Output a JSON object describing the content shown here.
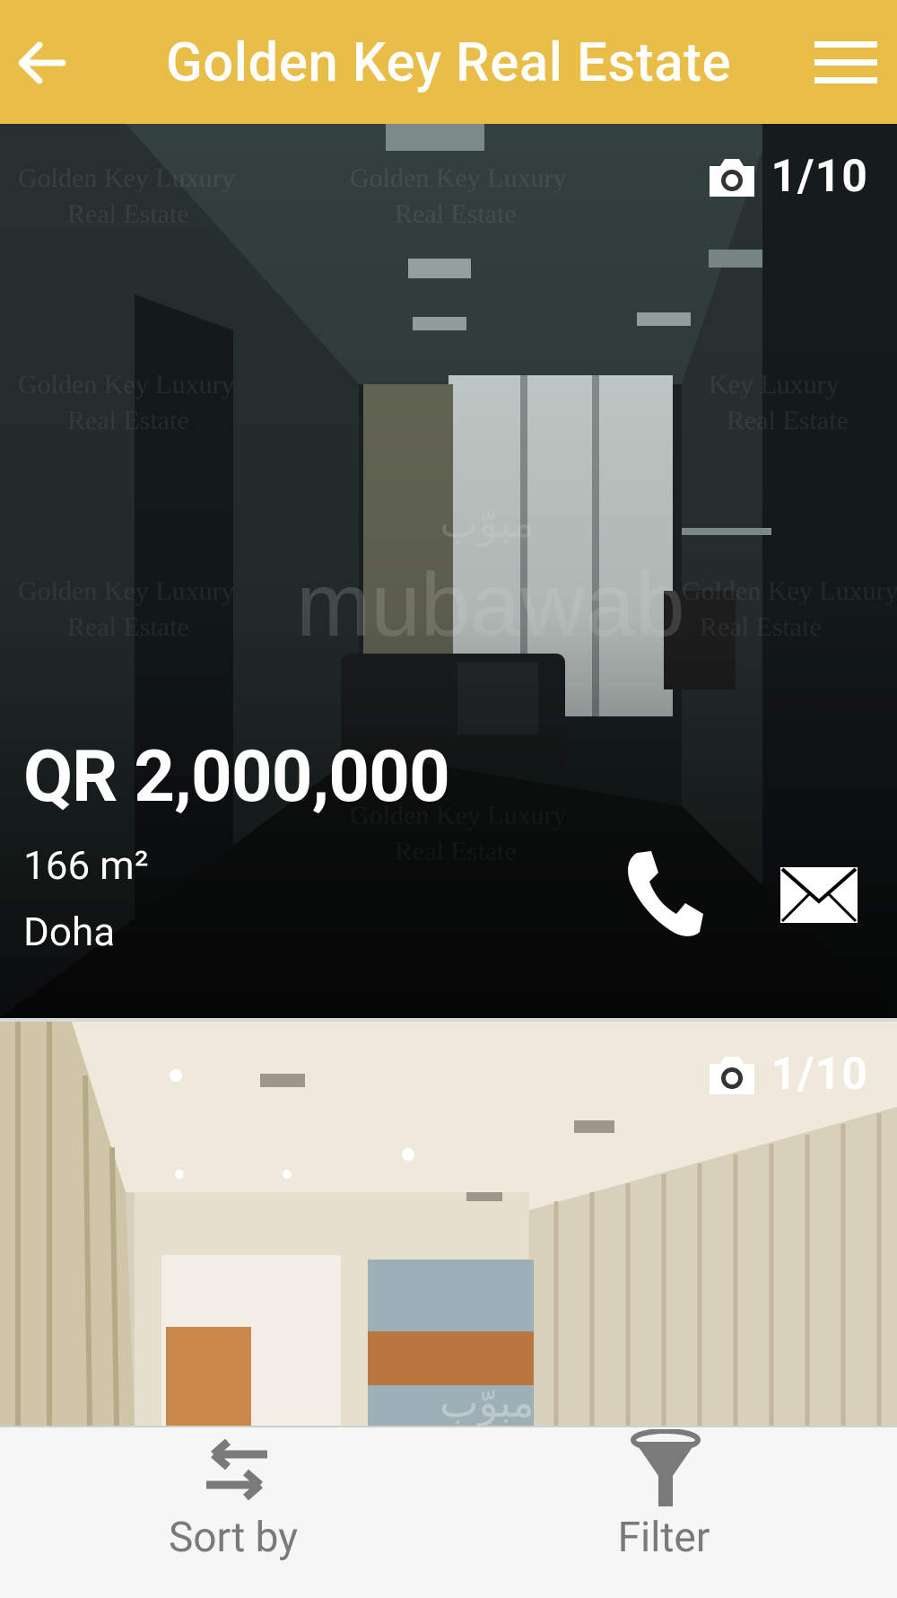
{
  "appbar": {
    "title": "Golden Key Real Estate"
  },
  "listings": [
    {
      "photo_counter": "1/10",
      "price": "QR 2,000,000",
      "area": "166 m²",
      "location": "Doha"
    },
    {
      "photo_counter": "1/10"
    }
  ],
  "photo_watermark": {
    "lines": [
      "Golden Key Luxury",
      "Real Estate"
    ],
    "brand_latin": "mubawab",
    "brand_arabic": "مبوّب"
  },
  "bottom_bar": {
    "sort_label": "Sort by",
    "filter_label": "Filter"
  },
  "colors": {
    "appbar_bg": "#E8BE48",
    "bottom_bar_bg": "#F6F6F6",
    "bottom_text": "#7A7A7A"
  },
  "icons": [
    "arrow-left-icon",
    "menu-icon",
    "camera-icon",
    "phone-icon",
    "mail-icon",
    "sort-arrows-icon",
    "filter-funnel-icon"
  ]
}
